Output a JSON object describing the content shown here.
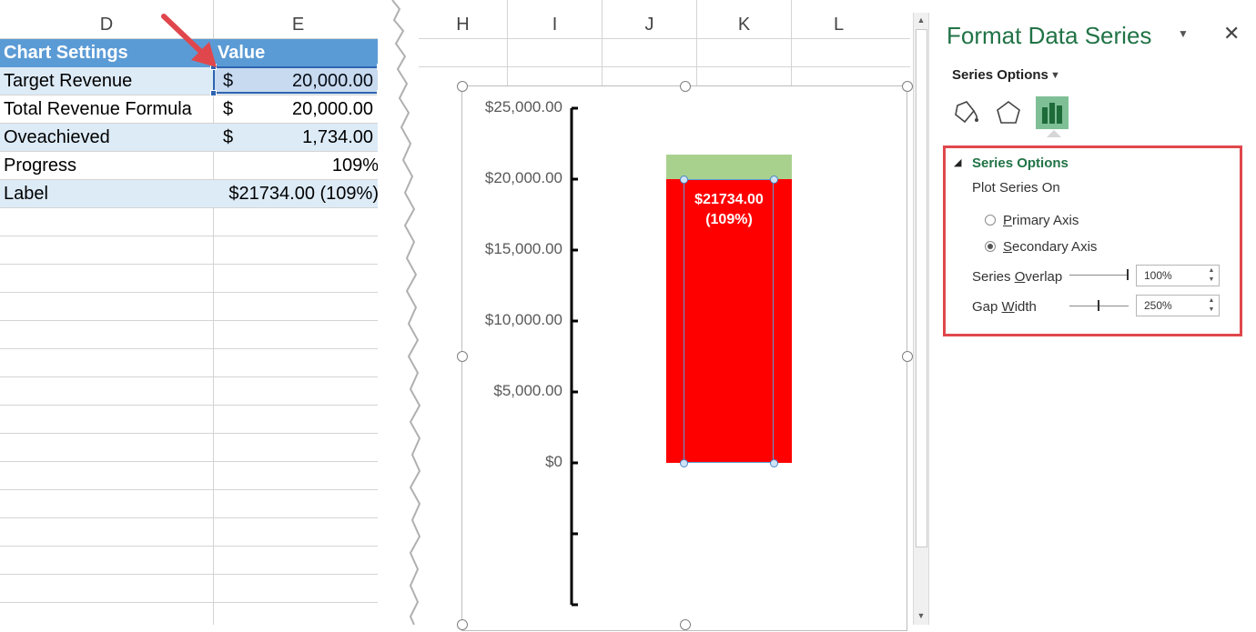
{
  "left_sheet": {
    "col_d": "D",
    "col_e": "E",
    "rows": [
      {
        "label": "Chart Settings",
        "value": "Value"
      },
      {
        "label": "Target Revenue",
        "currency": "$",
        "amount": "20,000.00"
      },
      {
        "label": "Total Revenue Formula",
        "currency": "$",
        "amount": "20,000.00"
      },
      {
        "label": "Oveachieved",
        "currency": "$",
        "amount": "1,734.00"
      },
      {
        "label": "Progress",
        "value": "109%"
      },
      {
        "label": "Label",
        "value": "$21734.00 (109%)"
      }
    ]
  },
  "mid_sheet": {
    "cols": [
      "H",
      "I",
      "J",
      "K",
      "L"
    ]
  },
  "chart_data": {
    "type": "bar",
    "stacked": true,
    "categories": [
      ""
    ],
    "series": [
      {
        "values": [
          20000
        ],
        "color": "#ff0000"
      },
      {
        "values": [
          1734
        ],
        "color": "#a9d18e"
      }
    ],
    "ylim": [
      0,
      25000
    ],
    "y_ticks": [
      "$25,000.00",
      "$20,000.00",
      "$15,000.00",
      "$10,000.00",
      "$5,000.00",
      "$0"
    ],
    "data_label_line1": "$21734.00",
    "data_label_line2": "(109%)",
    "xlabel": "",
    "ylabel": "",
    "title": "",
    "grid": false
  },
  "pane": {
    "title": "Format Data Series",
    "series_options_dd": "Series Options",
    "section_title": "Series Options",
    "plot_series_on": "Plot Series On",
    "primary_axis": "Primary Axis",
    "secondary_axis": "Secondary Axis",
    "selected_axis": "secondary",
    "series_overlap_label": "Series Overlap",
    "series_overlap_value": "100%",
    "series_overlap_level": 1.0,
    "gap_width_label": "Gap Width",
    "gap_width_value": "250%",
    "gap_width_level": 0.5,
    "icons": {
      "fill": "paint-bucket-icon",
      "effects": "pentagon-icon",
      "options": "bar-chart-icon",
      "close": "close-icon",
      "dropdown": "chevron-down-icon"
    }
  },
  "colors": {
    "accent": "#217346",
    "header_fill": "#5b9bd5",
    "band_fill": "#ddebf7",
    "highlight": "#e0474c"
  }
}
